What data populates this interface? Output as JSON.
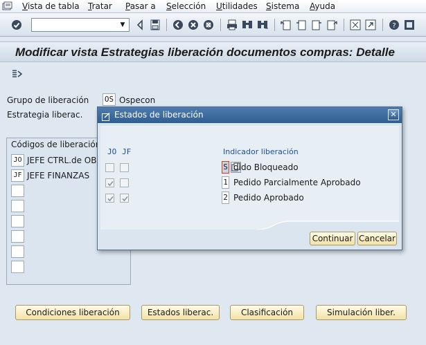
{
  "menubar": {
    "items": [
      {
        "label": "Vista de tabla",
        "underline": "V",
        "rest": "ista de tabla"
      },
      {
        "label": "Tratar",
        "underline": "T",
        "rest": "ratar"
      },
      {
        "label": "Pasar a",
        "underline": "P",
        "rest": "asar a"
      },
      {
        "label": "Selección",
        "underline": "S",
        "rest": "elección"
      },
      {
        "label": "Utilidades",
        "underline": "U",
        "rest": "tilidades"
      },
      {
        "label": "Sistema",
        "underline": "S",
        "rest": "istema"
      },
      {
        "label": "Ayuda",
        "underline": "A",
        "rest": "yuda"
      }
    ]
  },
  "toolbar": {
    "command_value": "",
    "icons": [
      "enter-icon",
      "back-icon",
      "save-icon",
      "back-nav-icon",
      "exit-icon",
      "cancel-icon",
      "print-icon",
      "find-icon",
      "find-next-icon",
      "first-page-icon",
      "previous-page-icon",
      "next-page-icon",
      "last-page-icon",
      "new-session-icon",
      "shortcut-icon",
      "help-icon",
      "customize-layout-icon"
    ]
  },
  "title": "Modificar vista Estrategias liberación documentos compras: Detalle",
  "form": {
    "group_label": "Grupo de liberación",
    "group_code": "OS",
    "group_name": "Ospecon",
    "strategy_label": "Estrategia liberac."
  },
  "codes_group": {
    "title": "Códigos de liberación",
    "rows": [
      {
        "code": "JO",
        "text": "JEFE CTRL.de OBR"
      },
      {
        "code": "JF",
        "text": "JEFE FINANZAS"
      },
      {
        "code": "",
        "text": ""
      },
      {
        "code": "",
        "text": ""
      },
      {
        "code": "",
        "text": ""
      },
      {
        "code": "",
        "text": ""
      },
      {
        "code": "",
        "text": ""
      },
      {
        "code": "",
        "text": ""
      }
    ]
  },
  "buttons": {
    "conditions": "Condiciones liberación",
    "states": "Estados liberac.",
    "classification": "Clasificación",
    "simulation": "Simulación liber."
  },
  "dialog": {
    "title": "Estados de liberación",
    "close": "✕",
    "col_jo": "JO",
    "col_jf": "JF",
    "col_indicator": "Indicador liberación",
    "rows": [
      {
        "jo": false,
        "jf": false,
        "code": "S",
        "text": "dido Bloqueado"
      },
      {
        "jo": true,
        "jf": false,
        "code": "1",
        "text": "Pedido Parcialmente Aprobado"
      },
      {
        "jo": true,
        "jf": true,
        "code": "2",
        "text": "Pedido Aprobado"
      }
    ],
    "continue_label": "Continuar",
    "cancel_label": "Cancelar"
  },
  "colors": {
    "background": "#dfe8f1",
    "dialog_title": "#2f5e93",
    "button_fill": "#f3e2a6",
    "focus_border": "#d33a1f",
    "column_header": "#1a4fa0"
  }
}
